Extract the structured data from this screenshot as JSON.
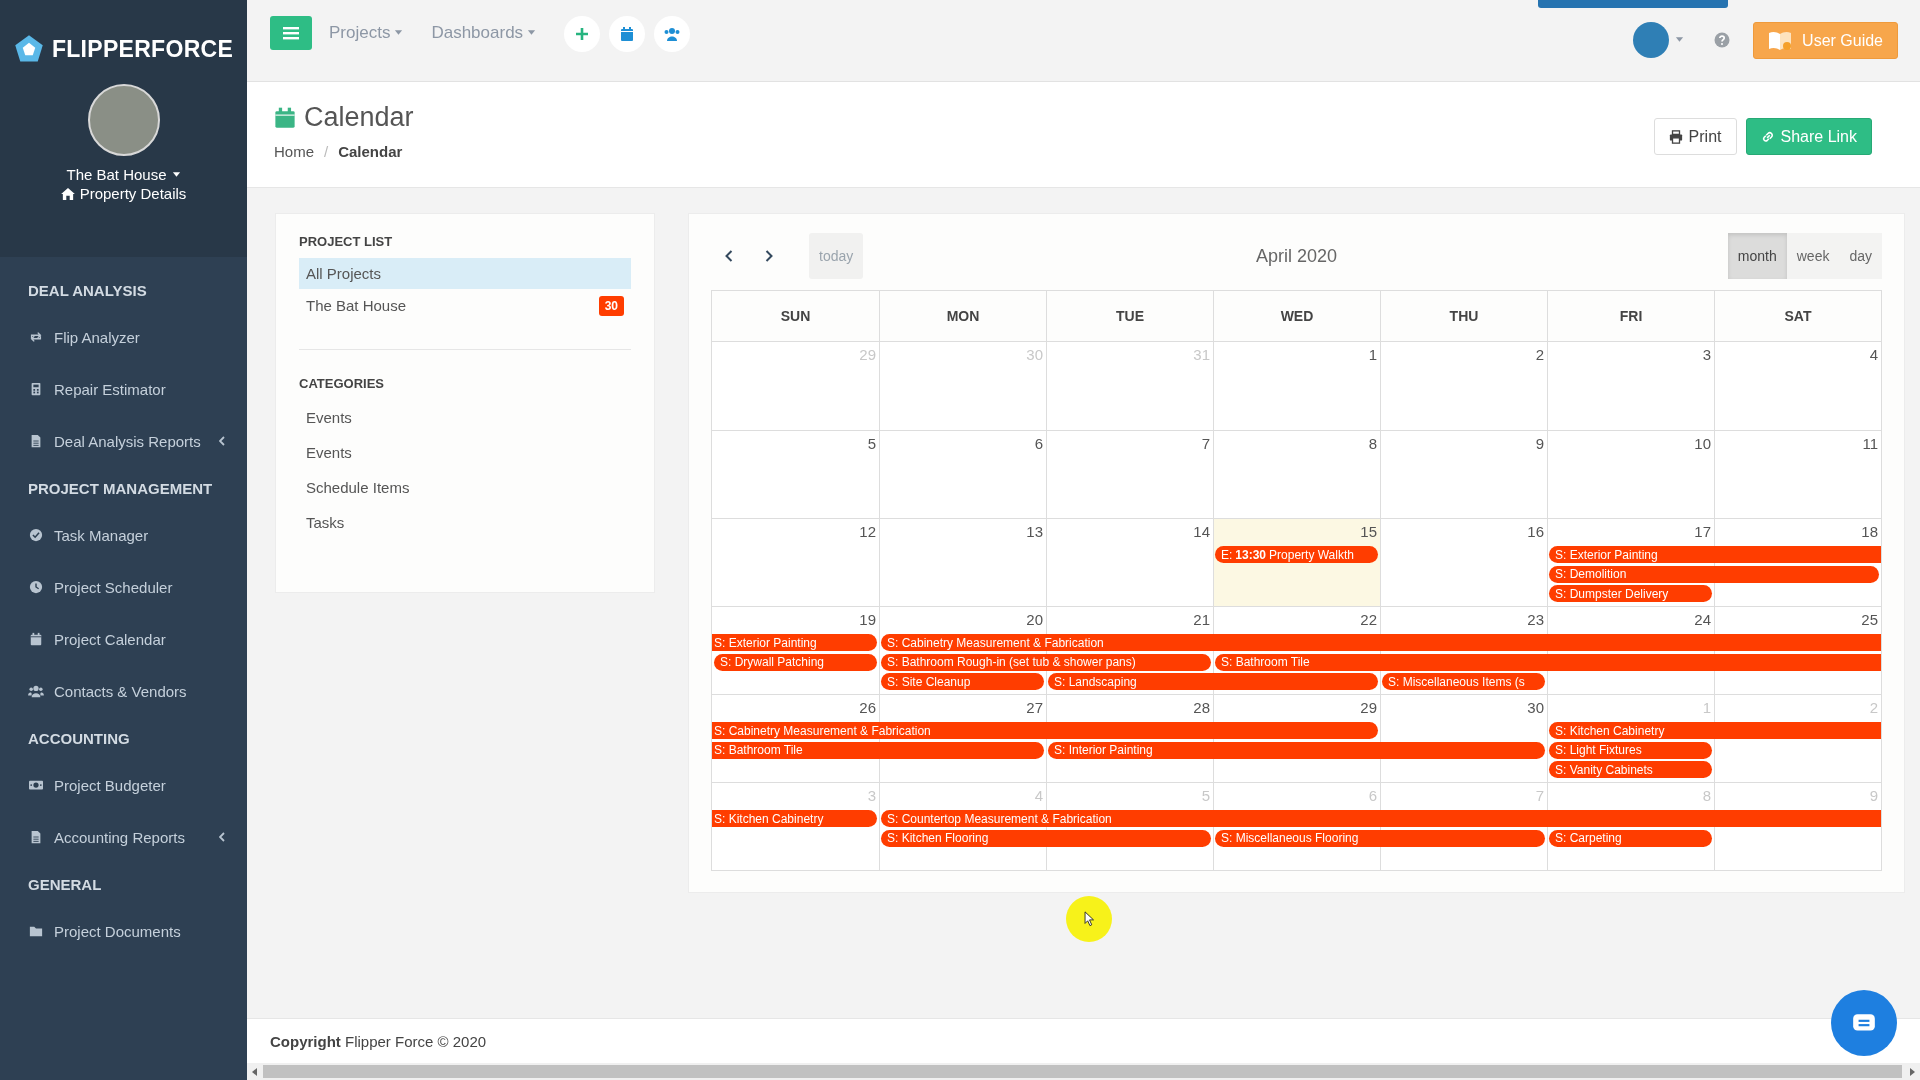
{
  "sidebar": {
    "brand": "FLIPPERFORCE",
    "property": {
      "name": "The Bat House",
      "link": "Property Details"
    },
    "sections": [
      {
        "heading": "DEAL ANALYSIS",
        "items": [
          {
            "label": "Flip Analyzer",
            "has_submenu": false
          },
          {
            "label": "Repair Estimator",
            "has_submenu": false
          },
          {
            "label": "Deal Analysis Reports",
            "has_submenu": true
          }
        ]
      },
      {
        "heading": "PROJECT MANAGEMENT",
        "items": [
          {
            "label": "Task Manager",
            "has_submenu": false
          },
          {
            "label": "Project Scheduler",
            "has_submenu": false
          },
          {
            "label": "Project Calendar",
            "has_submenu": false
          },
          {
            "label": "Contacts & Vendors",
            "has_submenu": false
          }
        ]
      },
      {
        "heading": "ACCOUNTING",
        "items": [
          {
            "label": "Project Budgeter",
            "has_submenu": false
          },
          {
            "label": "Accounting Reports",
            "has_submenu": true
          }
        ]
      },
      {
        "heading": "GENERAL",
        "items": [
          {
            "label": "Project Documents",
            "has_submenu": false
          }
        ]
      }
    ]
  },
  "topbar": {
    "menus": [
      {
        "label": "Projects"
      },
      {
        "label": "Dashboards"
      }
    ],
    "user_guide": "User Guide"
  },
  "page_header": {
    "title": "Calendar",
    "breadcrumb": {
      "separator": "/",
      "items": [
        {
          "label": "Home",
          "current": false
        },
        {
          "label": "Calendar",
          "current": true
        }
      ]
    },
    "buttons": [
      {
        "label": "Print",
        "kind": "print"
      },
      {
        "label": "Share Link",
        "kind": "share"
      }
    ]
  },
  "project_list": {
    "heading": "PROJECT LIST",
    "items": [
      {
        "label": "All Projects",
        "selected": true
      },
      {
        "label": "The Bat House",
        "selected": false,
        "badge": "30"
      }
    ]
  },
  "categories": {
    "heading": "CATEGORIES",
    "items": [
      "Events",
      "Events",
      "Schedule Items",
      "Tasks"
    ]
  },
  "calendar": {
    "title": "April 2020",
    "today_button": {
      "label": "today",
      "disabled": true
    },
    "views": [
      {
        "label": "month",
        "selected": true
      },
      {
        "label": "week",
        "selected": false
      },
      {
        "label": "day",
        "selected": false
      }
    ],
    "columns": [
      "SUN",
      "MON",
      "TUE",
      "WED",
      "THU",
      "FRI",
      "SAT"
    ],
    "weeks": [
      {
        "days": [
          {
            "label": "29",
            "other_month": true,
            "today": false
          },
          {
            "label": "30",
            "other_month": true,
            "today": false
          },
          {
            "label": "31",
            "other_month": true,
            "today": false
          },
          {
            "label": "1",
            "other_month": false,
            "today": false
          },
          {
            "label": "2",
            "other_month": false,
            "today": false
          },
          {
            "label": "3",
            "other_month": false,
            "today": false
          },
          {
            "label": "4",
            "other_month": false,
            "today": false
          }
        ]
      },
      {
        "days": [
          {
            "label": "5",
            "other_month": false,
            "today": false
          },
          {
            "label": "6",
            "other_month": false,
            "today": false
          },
          {
            "label": "7",
            "other_month": false,
            "today": false
          },
          {
            "label": "8",
            "other_month": false,
            "today": false
          },
          {
            "label": "9",
            "other_month": false,
            "today": false
          },
          {
            "label": "10",
            "other_month": false,
            "today": false
          },
          {
            "label": "11",
            "other_month": false,
            "today": false
          }
        ]
      },
      {
        "days": [
          {
            "label": "12",
            "other_month": false,
            "today": false
          },
          {
            "label": "13",
            "other_month": false,
            "today": false
          },
          {
            "label": "14",
            "other_month": false,
            "today": false
          },
          {
            "label": "15",
            "other_month": false,
            "today": true
          },
          {
            "label": "16",
            "other_month": false,
            "today": false
          },
          {
            "label": "17",
            "other_month": false,
            "today": false
          },
          {
            "label": "18",
            "other_month": false,
            "today": false
          }
        ],
        "lanes": [
          [
            {
              "kind": "empty"
            },
            {
              "kind": "empty"
            },
            {
              "kind": "empty"
            },
            {
              "kind": "event",
              "label": "E: **13:30** Property Walkth",
              "continued_before": false,
              "continues_after": false
            },
            {
              "kind": "empty"
            },
            {
              "kind": "event",
              "label": "S: Exterior Painting",
              "continued_before": false,
              "continues_after": true
            },
            {
              "kind": "span"
            }
          ],
          [
            {
              "kind": "empty"
            },
            {
              "kind": "empty"
            },
            {
              "kind": "empty"
            },
            {
              "kind": "empty"
            },
            {
              "kind": "empty"
            },
            {
              "kind": "event",
              "label": "S: Demolition",
              "continued_before": false,
              "continues_after": false
            },
            {
              "kind": "span"
            }
          ],
          [
            {
              "kind": "empty"
            },
            {
              "kind": "empty"
            },
            {
              "kind": "empty"
            },
            {
              "kind": "empty"
            },
            {
              "kind": "empty"
            },
            {
              "kind": "event",
              "label": "S: Dumpster Delivery",
              "continued_before": false,
              "continues_after": false
            },
            {
              "kind": "empty"
            }
          ]
        ]
      },
      {
        "days": [
          {
            "label": "19",
            "other_month": false,
            "today": false
          },
          {
            "label": "20",
            "other_month": false,
            "today": false
          },
          {
            "label": "21",
            "other_month": false,
            "today": false
          },
          {
            "label": "22",
            "other_month": false,
            "today": false
          },
          {
            "label": "23",
            "other_month": false,
            "today": false
          },
          {
            "label": "24",
            "other_month": false,
            "today": false
          },
          {
            "label": "25",
            "other_month": false,
            "today": false
          }
        ],
        "lanes": [
          [
            {
              "kind": "event",
              "label": "S: Exterior Painting",
              "continued_before": true,
              "continues_after": false
            },
            {
              "kind": "event",
              "label": "S: Cabinetry Measurement & Fabrication",
              "continued_before": false,
              "continues_after": true
            },
            {
              "kind": "span"
            },
            {
              "kind": "span"
            },
            {
              "kind": "span"
            },
            {
              "kind": "span"
            },
            {
              "kind": "span"
            }
          ],
          [
            {
              "kind": "event",
              "label": "S: Drywall Patching",
              "continued_before": false,
              "continues_after": false
            },
            {
              "kind": "event",
              "label": "S: Bathroom Rough-in (set tub & shower pans)",
              "continued_before": false,
              "continues_after": false
            },
            {
              "kind": "span"
            },
            {
              "kind": "event",
              "label": "S: Bathroom Tile",
              "continued_before": false,
              "continues_after": true
            },
            {
              "kind": "span"
            },
            {
              "kind": "span"
            },
            {
              "kind": "span"
            }
          ],
          [
            {
              "kind": "empty"
            },
            {
              "kind": "event",
              "label": "S: Site Cleanup",
              "continued_before": false,
              "continues_after": false
            },
            {
              "kind": "event",
              "label": "S: Landscaping",
              "continued_before": false,
              "continues_after": false
            },
            {
              "kind": "span"
            },
            {
              "kind": "event",
              "label": "S: Miscellaneous Items (s",
              "continued_before": false,
              "continues_after": false
            },
            {
              "kind": "empty"
            },
            {
              "kind": "empty"
            }
          ]
        ]
      },
      {
        "days": [
          {
            "label": "26",
            "other_month": false,
            "today": false
          },
          {
            "label": "27",
            "other_month": false,
            "today": false
          },
          {
            "label": "28",
            "other_month": false,
            "today": false
          },
          {
            "label": "29",
            "other_month": false,
            "today": false
          },
          {
            "label": "30",
            "other_month": false,
            "today": false
          },
          {
            "label": "1",
            "other_month": true,
            "today": false
          },
          {
            "label": "2",
            "other_month": true,
            "today": false
          }
        ],
        "lanes": [
          [
            {
              "kind": "event",
              "label": "S: Cabinetry Measurement & Fabrication",
              "continued_before": true,
              "continues_after": false
            },
            {
              "kind": "span"
            },
            {
              "kind": "span"
            },
            {
              "kind": "span"
            },
            {
              "kind": "empty"
            },
            {
              "kind": "event",
              "label": "S: Kitchen Cabinetry",
              "continued_before": false,
              "continues_after": true
            },
            {
              "kind": "span"
            }
          ],
          [
            {
              "kind": "event",
              "label": "S: Bathroom Tile",
              "continued_before": true,
              "continues_after": false
            },
            {
              "kind": "span"
            },
            {
              "kind": "event",
              "label": "S: Interior Painting",
              "continued_before": false,
              "continues_after": false
            },
            {
              "kind": "span"
            },
            {
              "kind": "span"
            },
            {
              "kind": "event",
              "label": "S: Light Fixtures",
              "continued_before": false,
              "continues_after": false
            },
            {
              "kind": "empty"
            }
          ],
          [
            {
              "kind": "empty"
            },
            {
              "kind": "empty"
            },
            {
              "kind": "empty"
            },
            {
              "kind": "empty"
            },
            {
              "kind": "empty"
            },
            {
              "kind": "event",
              "label": "S: Vanity Cabinets",
              "continued_before": false,
              "continues_after": false
            },
            {
              "kind": "empty"
            }
          ]
        ]
      },
      {
        "days": [
          {
            "label": "3",
            "other_month": true,
            "today": false
          },
          {
            "label": "4",
            "other_month": true,
            "today": false
          },
          {
            "label": "5",
            "other_month": true,
            "today": false
          },
          {
            "label": "6",
            "other_month": true,
            "today": false
          },
          {
            "label": "7",
            "other_month": true,
            "today": false
          },
          {
            "label": "8",
            "other_month": true,
            "today": false
          },
          {
            "label": "9",
            "other_month": true,
            "today": false
          }
        ],
        "lanes": [
          [
            {
              "kind": "event",
              "label": "S: Kitchen Cabinetry",
              "continued_before": true,
              "continues_after": false
            },
            {
              "kind": "event",
              "label": "S: Countertop Measurement & Fabrication",
              "continued_before": false,
              "continues_after": true
            },
            {
              "kind": "span"
            },
            {
              "kind": "span"
            },
            {
              "kind": "span"
            },
            {
              "kind": "span"
            },
            {
              "kind": "span"
            }
          ],
          [
            {
              "kind": "empty"
            },
            {
              "kind": "event",
              "label": "S: Kitchen Flooring",
              "continued_before": false,
              "continues_after": false
            },
            {
              "kind": "span"
            },
            {
              "kind": "event",
              "label": "S: Miscellaneous Flooring",
              "continued_before": false,
              "continues_after": false
            },
            {
              "kind": "span"
            },
            {
              "kind": "event",
              "label": "S: Carpeting",
              "continued_before": false,
              "continues_after": false
            }
          ]
        ]
      }
    ]
  },
  "footer": "**Copyright** Flipper Force © 2020"
}
